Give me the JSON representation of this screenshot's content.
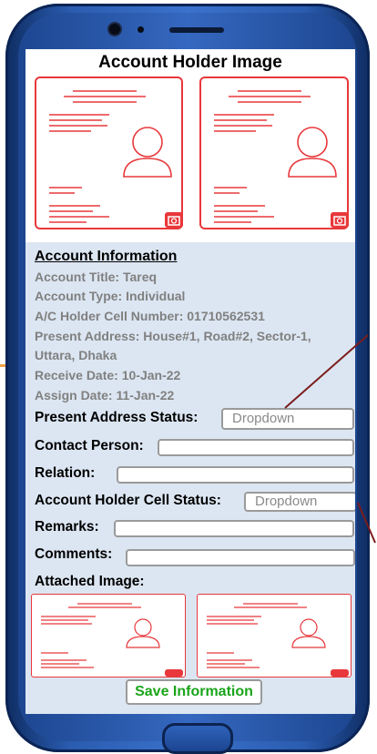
{
  "header": {
    "title": "Account Holder Image"
  },
  "account_info": {
    "heading": "Account Information",
    "title_line": "Account Title: Tareq",
    "type_line": "Account Type: Individual",
    "cell_line": "A/C Holder Cell Number: 01710562531",
    "address_line_1": "Present Address: House#1, Road#2, Sector-1,",
    "address_line_2": "Uttara, Dhaka",
    "receive_line": "Receive Date: 10-Jan-22",
    "assign_line": "Assign Date: 11-Jan-22"
  },
  "form": {
    "present_address_status_label": "Present Address Status:",
    "present_address_status_value": "Dropdown",
    "contact_person_label": "Contact Person:",
    "relation_label": "Relation:",
    "holder_cell_status_label": "Account Holder Cell Status:",
    "holder_cell_status_value": "Dropdown",
    "remarks_label": "Remarks:",
    "comments_label": "Comments:",
    "attached_image_label": "Attached Image:"
  },
  "actions": {
    "save_label": "Save Information"
  },
  "colors": {
    "phone_body": "#2a5cb0",
    "screen_bg": "#dce6f2",
    "card_accent": "#e8383b",
    "save_text": "#1aa51a",
    "info_text": "#808080"
  },
  "icons": [
    "id-card-icon",
    "camera-icon",
    "person-icon"
  ]
}
